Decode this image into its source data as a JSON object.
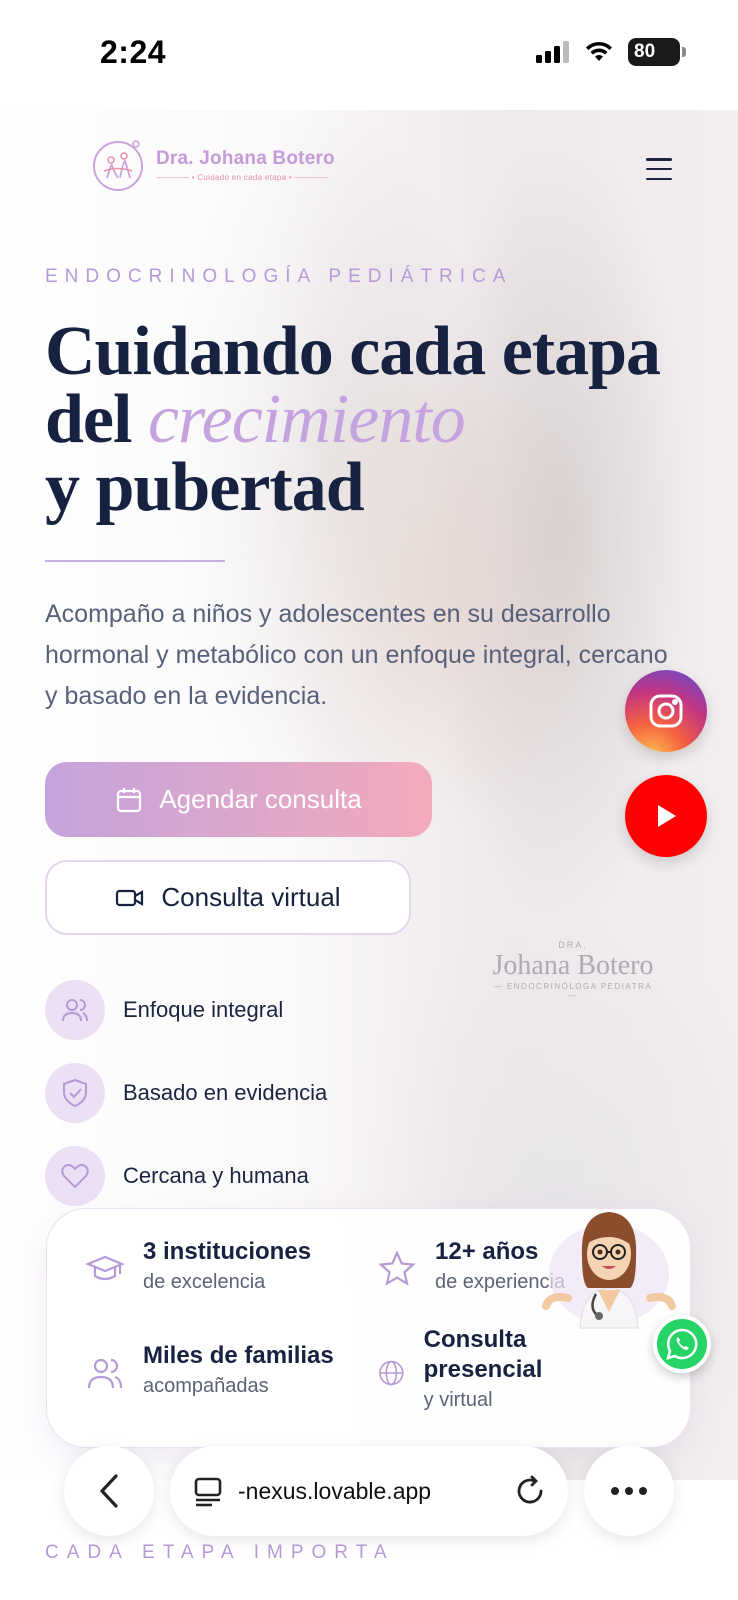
{
  "status_bar": {
    "time": "2:24",
    "battery": "80"
  },
  "header": {
    "brand": "Dra. Johana Botero",
    "tagline": "Cuidado en cada etapa"
  },
  "hero": {
    "eyebrow": "ENDOCRINOLOGÍA PEDIÁTRICA",
    "headline_line1": "Cuidando cada etapa",
    "headline_del": "del",
    "headline_accent": "crecimiento",
    "headline_line3": "y pubertad",
    "lead": "Acompaño a niños y adolescentes en su desarrollo hormonal y metabólico con un enfoque integral, cercano y basado en la evidencia.",
    "primary_cta": "Agendar consulta",
    "secondary_cta": "Consulta virtual",
    "coat_mark": {
      "dra": "DRA.",
      "name": "Johana Botero",
      "sub": "— ENDOCRINÓLOGA PEDIATRA —"
    }
  },
  "features": [
    {
      "label": "Enfoque integral",
      "icon": "users-icon"
    },
    {
      "label": "Basado en evidencia",
      "icon": "shield-check-icon"
    },
    {
      "label": "Cercana y humana",
      "icon": "heart-icon"
    }
  ],
  "stats": [
    {
      "title": "3 instituciones",
      "sub": "de excelencia",
      "icon": "graduation-cap-icon"
    },
    {
      "title": "12+ años",
      "sub": "de experiencia",
      "icon": "star-icon"
    },
    {
      "title": "Miles de familias",
      "sub": "acompañadas",
      "icon": "users-icon"
    },
    {
      "title": "Consulta presencial",
      "sub": "y virtual",
      "icon": "globe-icon"
    }
  ],
  "browser": {
    "url": "-nexus.lovable.app"
  },
  "next_section": {
    "eyebrow": "CADA ETAPA IMPORTA"
  },
  "colors": {
    "accent_lilac": "#c4a3df",
    "navy": "#172240",
    "pink": "#f2aabb",
    "whatsapp": "#25d366",
    "youtube": "#ff0000"
  }
}
